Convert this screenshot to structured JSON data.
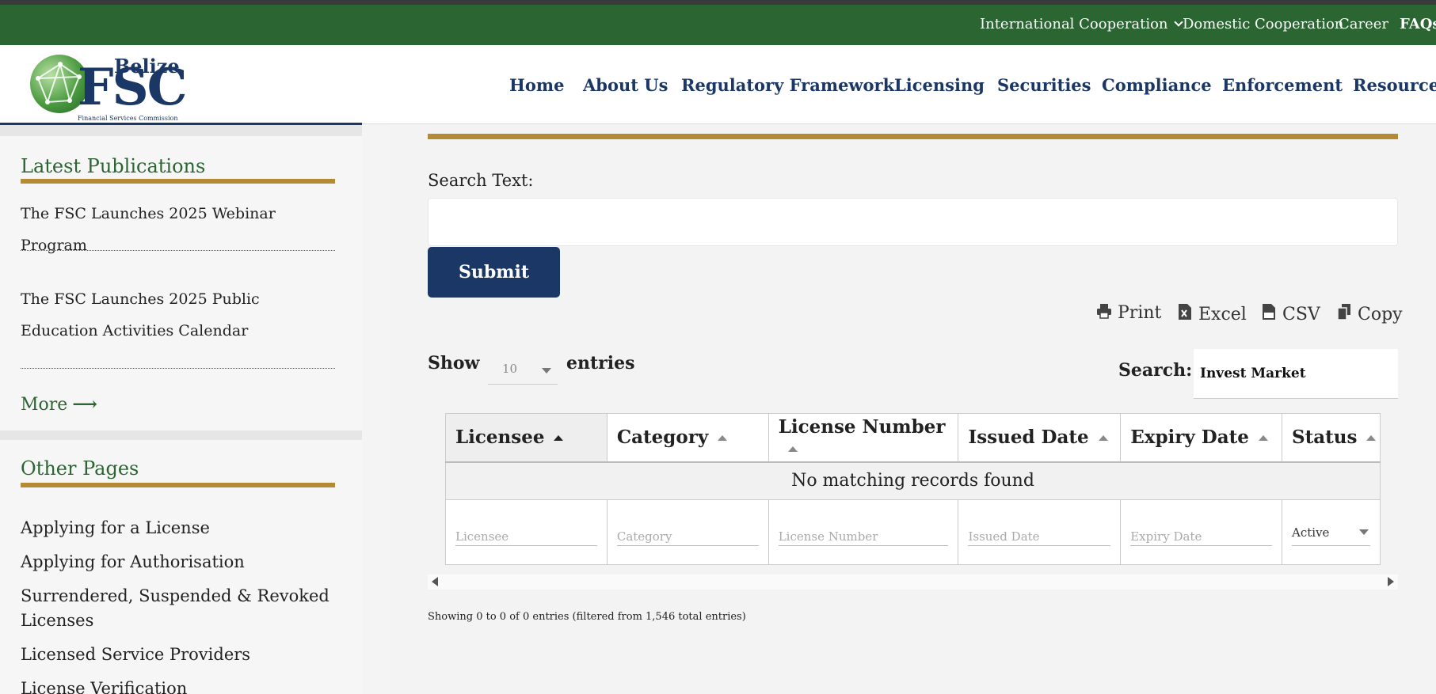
{
  "top_bar": {
    "international_cooperation": "International Cooperation",
    "domestic_cooperation": "Domestic Cooperation",
    "career": "Career",
    "faqs": "FAQs"
  },
  "logo": {
    "belize": "Belize",
    "fsc": "FSC",
    "subtitle": "Financial Services Commission"
  },
  "nav": {
    "items": [
      "Home",
      "About Us",
      "Regulatory Framework",
      "Licensing",
      "Securities",
      "Compliance",
      "Enforcement",
      "Resources"
    ]
  },
  "sidebar": {
    "latest_title": "Latest Publications",
    "publications": [
      "The FSC Launches 2025 Webinar Program",
      "The FSC Launches 2025 Public Education Activities Calendar"
    ],
    "more_label": "More",
    "more_arrow": "⟶",
    "other_title": "Other Pages",
    "other_pages": [
      "Applying for a License",
      "Applying for Authorisation",
      "Surrendered, Suspended & Revoked Licenses",
      "Licensed Service Providers",
      "License Verification"
    ]
  },
  "form": {
    "search_text_label": "Search Text:",
    "search_text_value": "",
    "submit_label": "Submit"
  },
  "export_buttons": {
    "print": "Print",
    "excel": "Excel",
    "csv": "CSV",
    "copy": "Copy"
  },
  "table_controls": {
    "show_label": "Show",
    "entries_per_page": "10",
    "entries_label": "entries",
    "search_label": "Search:",
    "search_value": "Invest Market"
  },
  "table": {
    "columns": [
      "Licensee",
      "Category",
      "License Number",
      "Issued Date",
      "Expiry Date",
      "Status"
    ],
    "empty_message": "No matching records found",
    "filters": {
      "licensee_placeholder": "Licensee",
      "category_placeholder": "Category",
      "license_number_placeholder": "License Number",
      "issued_date_placeholder": "Issued Date",
      "expiry_date_placeholder": "Expiry Date",
      "status_value": "Active"
    }
  },
  "table_info": "Showing 0 to 0 of 0 entries (filtered from 1,546 total entries)",
  "icons": [
    "chevron-down-icon",
    "arrow-right-icon",
    "print-icon",
    "excel-icon",
    "csv-icon",
    "copy-icon",
    "sort-up-icon",
    "scroll-left-icon",
    "scroll-right-icon"
  ],
  "colors": {
    "top_bar_green": "#2b6531",
    "navy": "#1b3766",
    "gold": "#b58a34",
    "sidebar_heading_green": "#2b6531"
  }
}
